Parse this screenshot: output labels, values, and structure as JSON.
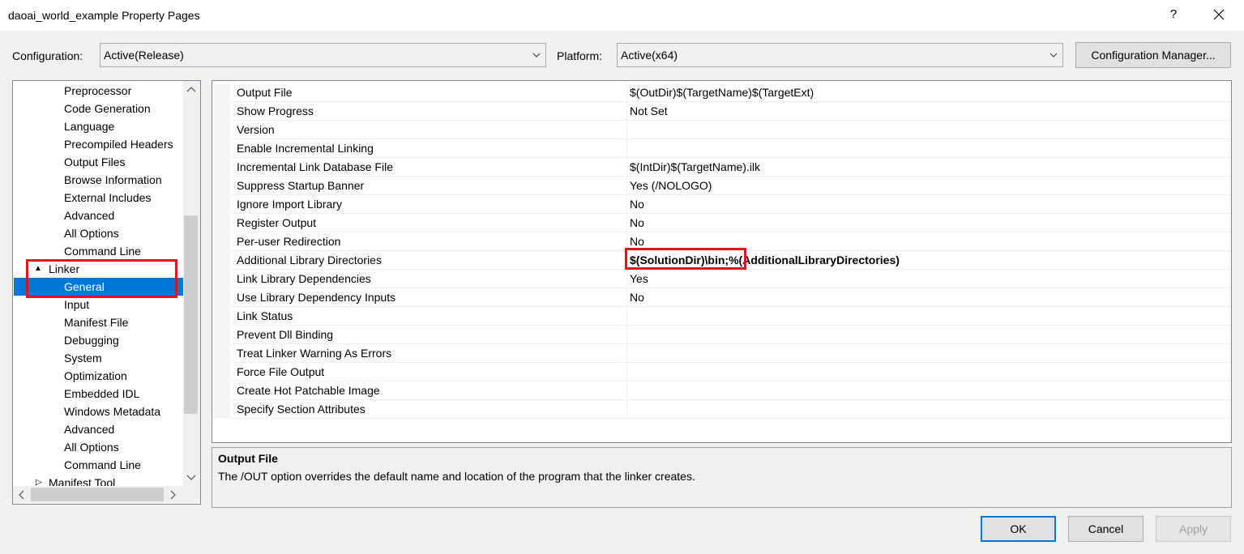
{
  "window": {
    "title": "daoai_world_example Property Pages",
    "help_label": "?",
    "close_icon": "close-icon"
  },
  "toolbar": {
    "configuration_label": "Configuration:",
    "configuration_value": "Active(Release)",
    "platform_label": "Platform:",
    "platform_value": "Active(x64)",
    "config_manager_label": "Configuration Manager..."
  },
  "tree": {
    "items": [
      {
        "label": "Preprocessor"
      },
      {
        "label": "Code Generation"
      },
      {
        "label": "Language"
      },
      {
        "label": "Precompiled Headers"
      },
      {
        "label": "Output Files"
      },
      {
        "label": "Browse Information"
      },
      {
        "label": "External Includes"
      },
      {
        "label": "Advanced"
      },
      {
        "label": "All Options"
      },
      {
        "label": "Command Line"
      },
      {
        "label": "Linker",
        "expander": "▲"
      },
      {
        "label": "General",
        "selected": true
      },
      {
        "label": "Input"
      },
      {
        "label": "Manifest File"
      },
      {
        "label": "Debugging"
      },
      {
        "label": "System"
      },
      {
        "label": "Optimization"
      },
      {
        "label": "Embedded IDL"
      },
      {
        "label": "Windows Metadata"
      },
      {
        "label": "Advanced"
      },
      {
        "label": "All Options"
      },
      {
        "label": "Command Line"
      },
      {
        "label": "Manifest Tool",
        "expander": "▷"
      }
    ]
  },
  "properties": [
    {
      "name": "Output File",
      "value": "$(OutDir)$(TargetName)$(TargetExt)"
    },
    {
      "name": "Show Progress",
      "value": "Not Set"
    },
    {
      "name": "Version",
      "value": ""
    },
    {
      "name": "Enable Incremental Linking",
      "value": ""
    },
    {
      "name": "Incremental Link Database File",
      "value": "$(IntDir)$(TargetName).ilk"
    },
    {
      "name": "Suppress Startup Banner",
      "value": "Yes (/NOLOGO)"
    },
    {
      "name": "Ignore Import Library",
      "value": "No"
    },
    {
      "name": "Register Output",
      "value": "No"
    },
    {
      "name": "Per-user Redirection",
      "value": "No"
    },
    {
      "name": "Additional Library Directories",
      "value": "$(SolutionDir)\\bin;%(AdditionalLibraryDirectories)",
      "bold": true
    },
    {
      "name": "Link Library Dependencies",
      "value": "Yes"
    },
    {
      "name": "Use Library Dependency Inputs",
      "value": "No"
    },
    {
      "name": "Link Status",
      "value": ""
    },
    {
      "name": "Prevent Dll Binding",
      "value": ""
    },
    {
      "name": "Treat Linker Warning As Errors",
      "value": ""
    },
    {
      "name": "Force File Output",
      "value": ""
    },
    {
      "name": "Create Hot Patchable Image",
      "value": ""
    },
    {
      "name": "Specify Section Attributes",
      "value": ""
    }
  ],
  "description": {
    "title": "Output File",
    "text": "The /OUT option overrides the default name and location of the program that the linker creates."
  },
  "buttons": {
    "ok": "OK",
    "cancel": "Cancel",
    "apply": "Apply"
  },
  "colors": {
    "selection": "#0078d7",
    "highlight_box": "#e0161b"
  }
}
